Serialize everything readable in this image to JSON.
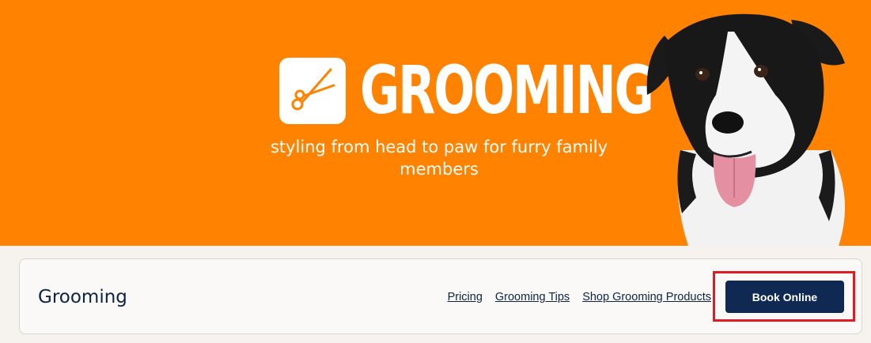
{
  "hero": {
    "title": "GROOMING",
    "subtitle": "styling from head to paw for furry family members",
    "icon": "scissors-icon",
    "background_color": "#ff8300"
  },
  "subnav": {
    "title": "Grooming",
    "links": [
      "Pricing",
      "Grooming Tips",
      "Shop Grooming Products"
    ],
    "book_button_label": "Book Online",
    "button_color": "#0f2952",
    "highlight_color": "#e01b24"
  }
}
